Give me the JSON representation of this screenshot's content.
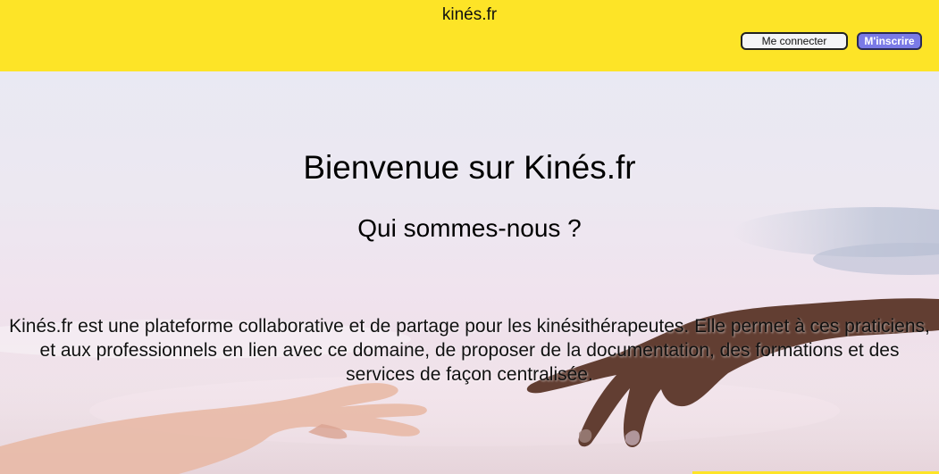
{
  "header": {
    "brand": "kinés.fr",
    "login_label": "Me connecter",
    "register_label": "M'inscrire",
    "background_color": "#fde427"
  },
  "hero": {
    "title": "Bienvenue sur Kinés.fr",
    "subtitle": "Qui sommes-nous ?",
    "description": "Kinés.fr est une plateforme collaborative et de partage pour les kinésithérapeutes. Elle permet à ces praticiens, et aux professionnels en lien avec ce domaine, de proposer de la documentation, des formations et des services de façon centralisée."
  }
}
